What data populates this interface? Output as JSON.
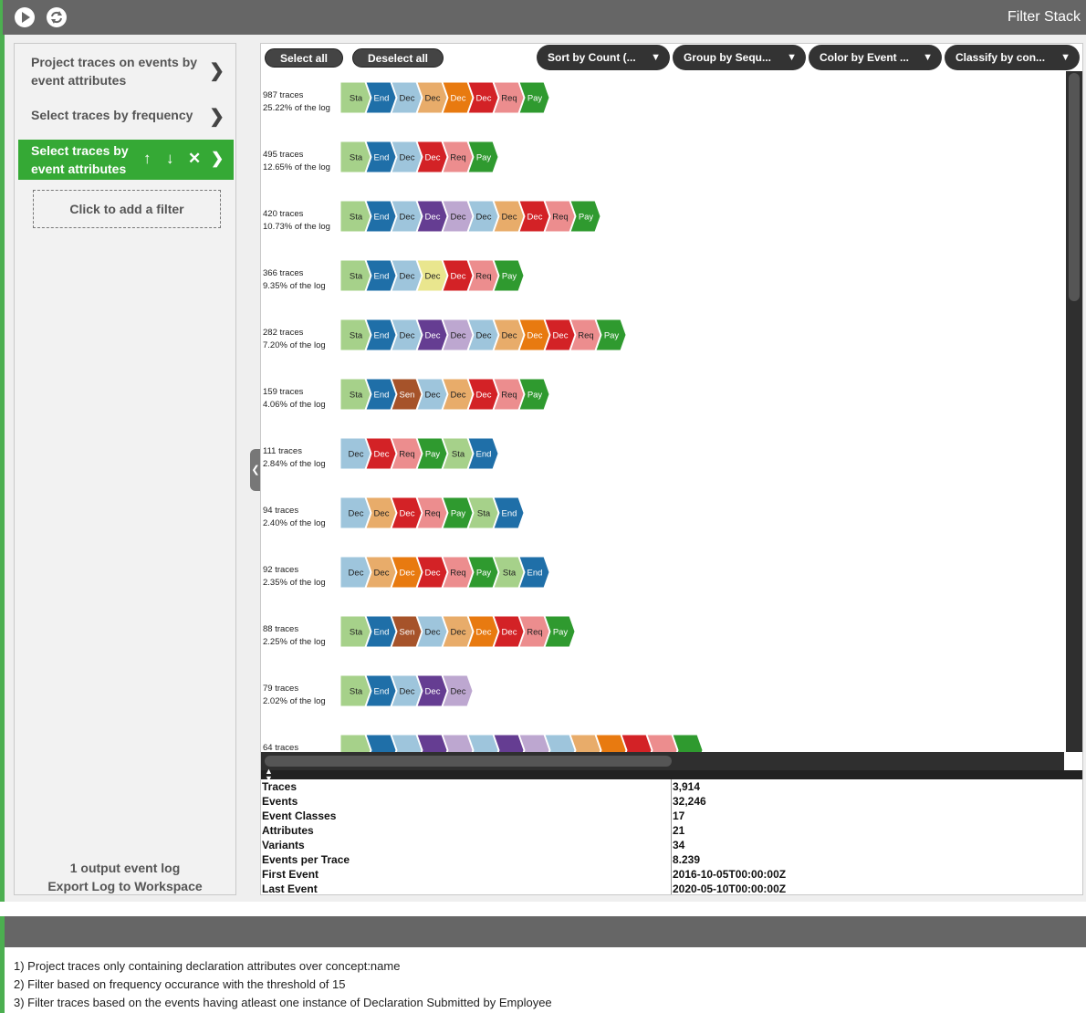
{
  "topbar": {
    "title": "Filter Stack",
    "play_icon": "play-icon",
    "refresh_icon": "refresh-icon"
  },
  "filters": {
    "items": [
      {
        "label_line1": "Project traces on events by",
        "label_line2": "event attributes"
      },
      {
        "label_line1": "Select traces by frequency",
        "label_line2": ""
      },
      {
        "label_line1": "Select traces by",
        "label_line2": "event attributes",
        "active": true
      }
    ],
    "add_filter": "Click to add a filter",
    "output_log": "1 output event log",
    "export_log": "Export Log to Workspace"
  },
  "toolbar": {
    "select_all": "Select all",
    "deselect_all": "Deselect all",
    "sort": "Sort by Count (...",
    "group": "Group by Sequ...",
    "color": "Color by Event ...",
    "classify": "Classify by con..."
  },
  "palette": {
    "Sta": "#a6d18a",
    "End": "#1f6fa8",
    "Dec": "#9ec5dc",
    "DecO": "#e8ac6a",
    "DecR": "#d32226",
    "DecOr": "#e87a10",
    "Req": "#ec8d8e",
    "Pay": "#2f9a2f",
    "DecP": "#653d92",
    "DecL": "#bda7d0",
    "DecY": "#e9e68e",
    "Sen": "#a6532a"
  },
  "traces": [
    {
      "count": "987 traces",
      "pct": "25.22% of the log",
      "events": [
        [
          "Sta",
          "Sta"
        ],
        [
          "End",
          "End"
        ],
        [
          "Dec",
          "Dec"
        ],
        [
          "Dec",
          "DecO"
        ],
        [
          "Dec",
          "DecOr"
        ],
        [
          "Dec",
          "DecR"
        ],
        [
          "Req",
          "Req"
        ],
        [
          "Pay",
          "Pay"
        ]
      ]
    },
    {
      "count": "495 traces",
      "pct": "12.65% of the log",
      "events": [
        [
          "Sta",
          "Sta"
        ],
        [
          "End",
          "End"
        ],
        [
          "Dec",
          "Dec"
        ],
        [
          "Dec",
          "DecR"
        ],
        [
          "Req",
          "Req"
        ],
        [
          "Pay",
          "Pay"
        ]
      ]
    },
    {
      "count": "420 traces",
      "pct": "10.73% of the log",
      "events": [
        [
          "Sta",
          "Sta"
        ],
        [
          "End",
          "End"
        ],
        [
          "Dec",
          "Dec"
        ],
        [
          "Dec",
          "DecP"
        ],
        [
          "Dec",
          "DecL"
        ],
        [
          "Dec",
          "Dec"
        ],
        [
          "Dec",
          "DecO"
        ],
        [
          "Dec",
          "DecR"
        ],
        [
          "Req",
          "Req"
        ],
        [
          "Pay",
          "Pay"
        ]
      ]
    },
    {
      "count": "366 traces",
      "pct": "9.35% of the log",
      "events": [
        [
          "Sta",
          "Sta"
        ],
        [
          "End",
          "End"
        ],
        [
          "Dec",
          "Dec"
        ],
        [
          "Dec",
          "DecY"
        ],
        [
          "Dec",
          "DecR"
        ],
        [
          "Req",
          "Req"
        ],
        [
          "Pay",
          "Pay"
        ]
      ]
    },
    {
      "count": "282 traces",
      "pct": "7.20% of the log",
      "events": [
        [
          "Sta",
          "Sta"
        ],
        [
          "End",
          "End"
        ],
        [
          "Dec",
          "Dec"
        ],
        [
          "Dec",
          "DecP"
        ],
        [
          "Dec",
          "DecL"
        ],
        [
          "Dec",
          "Dec"
        ],
        [
          "Dec",
          "DecO"
        ],
        [
          "Dec",
          "DecOr"
        ],
        [
          "Dec",
          "DecR"
        ],
        [
          "Req",
          "Req"
        ],
        [
          "Pay",
          "Pay"
        ]
      ]
    },
    {
      "count": "159 traces",
      "pct": "4.06% of the log",
      "events": [
        [
          "Sta",
          "Sta"
        ],
        [
          "End",
          "End"
        ],
        [
          "Sen",
          "Sen"
        ],
        [
          "Dec",
          "Dec"
        ],
        [
          "Dec",
          "DecO"
        ],
        [
          "Dec",
          "DecR"
        ],
        [
          "Req",
          "Req"
        ],
        [
          "Pay",
          "Pay"
        ]
      ]
    },
    {
      "count": "111 traces",
      "pct": "2.84% of the log",
      "events": [
        [
          "Dec",
          "Dec"
        ],
        [
          "Dec",
          "DecR"
        ],
        [
          "Req",
          "Req"
        ],
        [
          "Pay",
          "Pay"
        ],
        [
          "Sta",
          "Sta"
        ],
        [
          "End",
          "End"
        ]
      ]
    },
    {
      "count": "94 traces",
      "pct": "2.40% of the log",
      "events": [
        [
          "Dec",
          "Dec"
        ],
        [
          "Dec",
          "DecO"
        ],
        [
          "Dec",
          "DecR"
        ],
        [
          "Req",
          "Req"
        ],
        [
          "Pay",
          "Pay"
        ],
        [
          "Sta",
          "Sta"
        ],
        [
          "End",
          "End"
        ]
      ]
    },
    {
      "count": "92 traces",
      "pct": "2.35% of the log",
      "events": [
        [
          "Dec",
          "Dec"
        ],
        [
          "Dec",
          "DecO"
        ],
        [
          "Dec",
          "DecOr"
        ],
        [
          "Dec",
          "DecR"
        ],
        [
          "Req",
          "Req"
        ],
        [
          "Pay",
          "Pay"
        ],
        [
          "Sta",
          "Sta"
        ],
        [
          "End",
          "End"
        ]
      ]
    },
    {
      "count": "88 traces",
      "pct": "2.25% of the log",
      "events": [
        [
          "Sta",
          "Sta"
        ],
        [
          "End",
          "End"
        ],
        [
          "Sen",
          "Sen"
        ],
        [
          "Dec",
          "Dec"
        ],
        [
          "Dec",
          "DecO"
        ],
        [
          "Dec",
          "DecOr"
        ],
        [
          "Dec",
          "DecR"
        ],
        [
          "Req",
          "Req"
        ],
        [
          "Pay",
          "Pay"
        ]
      ]
    },
    {
      "count": "79 traces",
      "pct": "2.02% of the log",
      "events": [
        [
          "Sta",
          "Sta"
        ],
        [
          "End",
          "End"
        ],
        [
          "Dec",
          "Dec"
        ],
        [
          "Dec",
          "DecP"
        ],
        [
          "Dec",
          "DecL"
        ]
      ]
    },
    {
      "count": "64 traces",
      "pct": "",
      "events": [
        [
          "",
          "Sta"
        ],
        [
          "",
          "End"
        ],
        [
          "",
          "Dec"
        ],
        [
          "",
          "DecP"
        ],
        [
          "",
          "DecL"
        ],
        [
          "",
          "Dec"
        ],
        [
          "",
          "DecP"
        ],
        [
          "",
          "DecL"
        ],
        [
          "",
          "Dec"
        ],
        [
          "",
          "DecO"
        ],
        [
          "",
          "DecOr"
        ],
        [
          "",
          "DecR"
        ],
        [
          "",
          "Req"
        ],
        [
          "",
          "Pay"
        ]
      ]
    }
  ],
  "stats": [
    {
      "label": "Traces",
      "value": "3,914"
    },
    {
      "label": "Events",
      "value": "32,246"
    },
    {
      "label": "Event Classes",
      "value": "17"
    },
    {
      "label": "Attributes",
      "value": "21"
    },
    {
      "label": "Variants",
      "value": "34"
    },
    {
      "label": "Events per Trace",
      "value": "8.239"
    },
    {
      "label": "First Event",
      "value": "2016-10-05T00:00:00Z"
    },
    {
      "label": "Last Event",
      "value": "2020-05-10T00:00:00Z"
    }
  ],
  "notes": [
    "1) Project traces only containing declaration attributes over concept:name",
    "2) Filter based on frequency occurance with the threshold of 15",
    "3) Filter traces based on the events having atleast one instance of Declaration Submitted by Employee"
  ]
}
